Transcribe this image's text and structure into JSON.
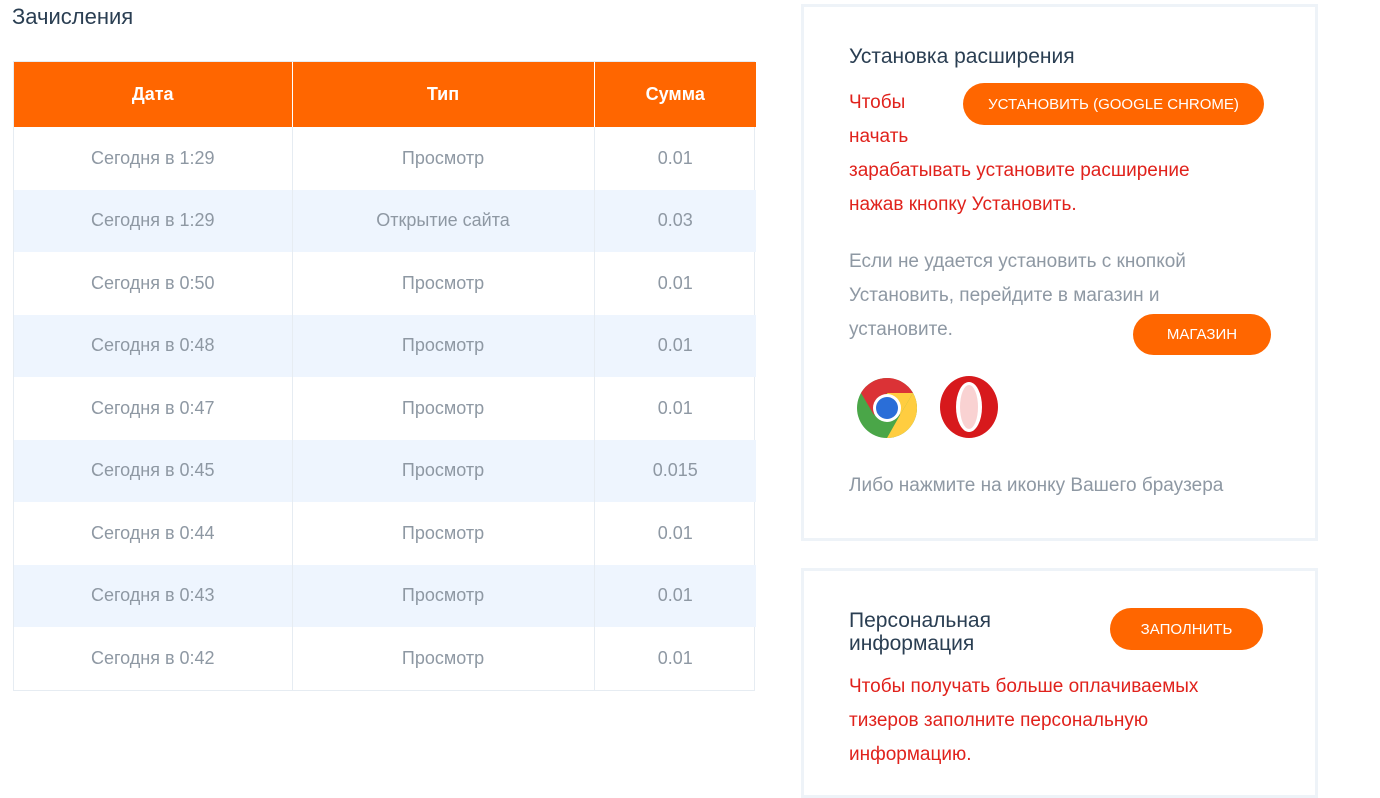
{
  "page": {
    "title": "Зачисления"
  },
  "table": {
    "headers": [
      "Дата",
      "Тип",
      "Сумма"
    ],
    "rows": [
      [
        "Сегодня в 1:29",
        "Просмотр",
        "0.01"
      ],
      [
        "Сегодня в 1:29",
        "Открытие сайта",
        "0.03"
      ],
      [
        "Сегодня в 0:50",
        "Просмотр",
        "0.01"
      ],
      [
        "Сегодня в 0:48",
        "Просмотр",
        "0.01"
      ],
      [
        "Сегодня в 0:47",
        "Просмотр",
        "0.01"
      ],
      [
        "Сегодня в 0:45",
        "Просмотр",
        "0.015"
      ],
      [
        "Сегодня в 0:44",
        "Просмотр",
        "0.01"
      ],
      [
        "Сегодня в 0:43",
        "Просмотр",
        "0.01"
      ],
      [
        "Сегодня в 0:42",
        "Просмотр",
        "0.01"
      ]
    ]
  },
  "extension": {
    "title": "Установка расширения",
    "install_button": "Установить (Google Chrome)",
    "red_line1": "Чтобы",
    "red_line2": "начать",
    "red_line3": "зарабатывать установите расширение",
    "red_line4": "нажав кнопку Установить.",
    "grey_line1": "Если не удается установить с кнопкой",
    "grey_line2": "Установить, перейдите в магазин и",
    "grey_line3": "установите.",
    "store_button": "Магазин",
    "browser_hint": "Либо нажмите на иконку Вашего браузера"
  },
  "personal": {
    "title_line1": "Персональная",
    "title_line2": "информация",
    "fill_button": "Заполнить",
    "red_line1": "Чтобы получать больше оплачиваемых",
    "red_line2": "тизеров заполните персональную",
    "red_line3": "информацию."
  },
  "colors": {
    "accent": "#ff6600",
    "alert": "#e0221c",
    "row_alt": "#eef5fe"
  }
}
